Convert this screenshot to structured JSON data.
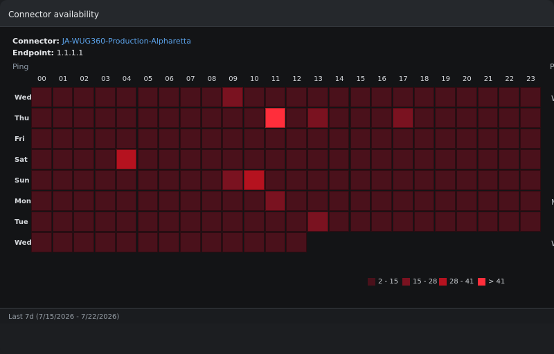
{
  "window": {
    "title": "Connector availability"
  },
  "connector": {
    "label": "Connector:",
    "value": "JA-WUG360-Production-Alpharetta"
  },
  "endpoint": {
    "label": "Endpoint:",
    "value": "1.1.1.1"
  },
  "section": {
    "label": "Ping",
    "right_cut_label": "P"
  },
  "heatmap": {
    "hours": [
      "00",
      "01",
      "02",
      "03",
      "04",
      "05",
      "06",
      "07",
      "08",
      "09",
      "10",
      "11",
      "12",
      "13",
      "14",
      "15",
      "16",
      "17",
      "18",
      "19",
      "20",
      "21",
      "22",
      "23"
    ],
    "days": [
      "Wed",
      "Thu",
      "Fri",
      "Sat",
      "Sun",
      "Mon",
      "Tue",
      "Wed"
    ],
    "levels": [
      [
        1,
        1,
        1,
        1,
        1,
        1,
        1,
        1,
        1,
        2,
        1,
        1,
        1,
        1,
        1,
        1,
        1,
        1,
        1,
        1,
        1,
        1,
        1,
        1
      ],
      [
        1,
        1,
        1,
        1,
        1,
        1,
        1,
        1,
        1,
        1,
        1,
        4,
        1,
        2,
        1,
        1,
        1,
        2,
        1,
        1,
        1,
        1,
        1,
        1
      ],
      [
        1,
        1,
        1,
        1,
        1,
        1,
        1,
        1,
        1,
        1,
        1,
        1,
        1,
        1,
        1,
        1,
        1,
        1,
        1,
        1,
        1,
        1,
        1,
        1
      ],
      [
        1,
        1,
        1,
        1,
        3,
        1,
        1,
        1,
        1,
        1,
        1,
        1,
        1,
        1,
        1,
        1,
        1,
        1,
        1,
        1,
        1,
        1,
        1,
        1
      ],
      [
        1,
        1,
        1,
        1,
        1,
        1,
        1,
        1,
        1,
        2,
        3,
        1,
        1,
        1,
        1,
        1,
        1,
        1,
        1,
        1,
        1,
        1,
        1,
        1
      ],
      [
        1,
        1,
        1,
        1,
        1,
        1,
        1,
        1,
        1,
        1,
        1,
        2,
        1,
        1,
        1,
        1,
        1,
        1,
        1,
        1,
        1,
        1,
        1,
        1
      ],
      [
        1,
        1,
        1,
        1,
        1,
        1,
        1,
        1,
        1,
        1,
        1,
        1,
        1,
        2,
        1,
        1,
        1,
        1,
        1,
        1,
        1,
        1,
        1,
        1
      ],
      [
        1,
        1,
        1,
        1,
        1,
        1,
        1,
        1,
        1,
        1,
        1,
        1,
        1,
        0,
        0,
        0,
        0,
        0,
        0,
        0,
        0,
        0,
        0,
        0
      ]
    ],
    "level_colors": [
      "#131416",
      "#4a111b",
      "#7a1220",
      "#b5121f",
      "#ff2e3b"
    ],
    "right_cut_days": [
      "W",
      "",
      "",
      "",
      "",
      "M",
      "",
      "W"
    ]
  },
  "legend": [
    {
      "label": "2 - 15",
      "color": "#4a111b"
    },
    {
      "label": "15 - 28",
      "color": "#7a1220"
    },
    {
      "label": "28 - 41",
      "color": "#b5121f"
    },
    {
      "label": "> 41",
      "color": "#ff2e3b"
    }
  ],
  "footer": {
    "range": "Last 7d (7/15/2026 - 7/22/2026)"
  }
}
